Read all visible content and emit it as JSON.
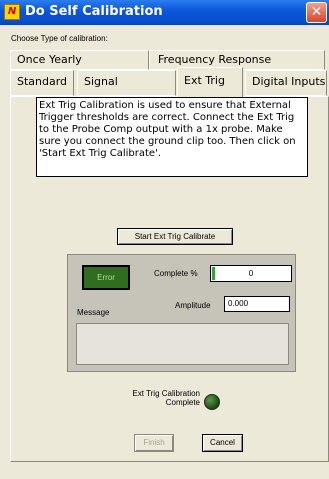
{
  "window": {
    "title": "Do Self Calibration",
    "app_icon": "N",
    "close": "✕"
  },
  "choose_label": "Choose Type of calibration:",
  "tabs_row1": [
    "Once Yearly",
    "Frequency Response"
  ],
  "tabs_row2": [
    "Standard",
    "Signal Generator",
    "Ext Trig",
    "Digital Inputs"
  ],
  "active_tab": "Ext Trig",
  "description": "Ext Trig Calibration is used to ensure  that External Trigger thresholds are correct. Connect the Ext Trig to the Probe Comp output with a 1x probe. Make sure you connect the ground clip too. Then click on 'Start Ext Trig Calibrate'.",
  "start_button": "Start Ext Trig Calibrate",
  "status": {
    "error_label": "Error",
    "complete_label": "Complete %",
    "complete_value": "0",
    "complete_fraction": 0.0,
    "amplitude_label": "Amplitude",
    "amplitude_value": "0.000",
    "message_label": "Message",
    "message_value": ""
  },
  "calibration_complete_label": "Ext Trig Calibration Complete",
  "finish_button": "Finish",
  "cancel_button": "Cancel",
  "colors": {
    "title_bar": "#0a55d8",
    "led_off": "#2e6e1e",
    "progress": "#3aa03a"
  }
}
